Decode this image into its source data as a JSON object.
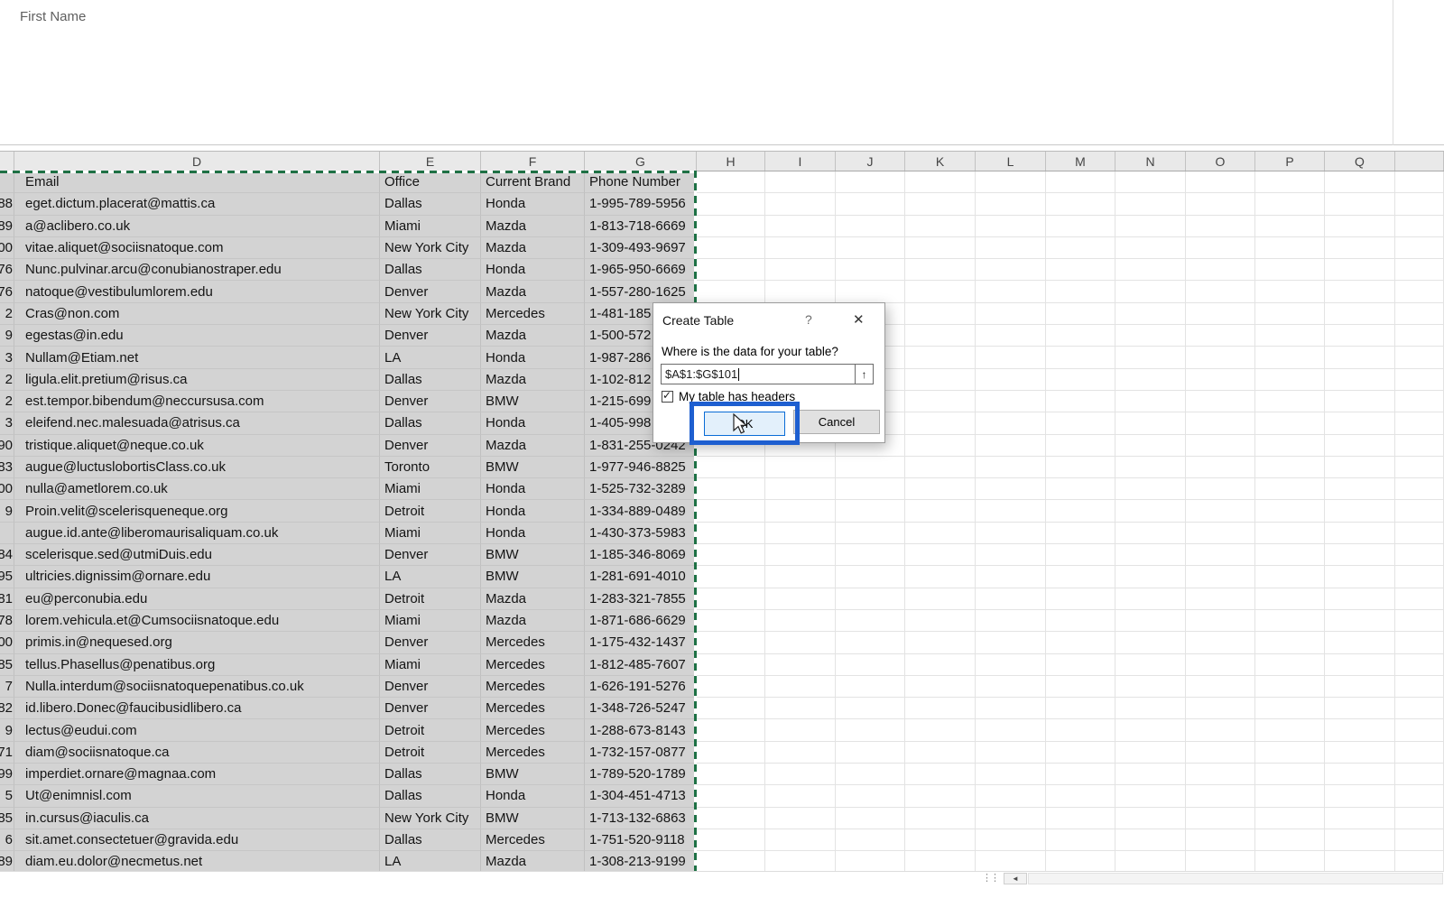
{
  "top": {
    "formula_text": "First Name"
  },
  "sheet": {
    "column_letters": [
      "",
      "D",
      "E",
      "F",
      "G",
      "H",
      "I",
      "J",
      "K",
      "L",
      "M",
      "N",
      "O",
      "P",
      "Q",
      ""
    ],
    "header_row": {
      "c": "",
      "email": "Email",
      "office": "Office",
      "brand": "Current Brand",
      "phone": "Phone Number"
    },
    "rows": [
      {
        "c": "88",
        "email": "eget.dictum.placerat@mattis.ca",
        "office": "Dallas",
        "brand": "Honda",
        "phone": "1-995-789-5956"
      },
      {
        "c": "89",
        "email": "a@aclibero.co.uk",
        "office": "Miami",
        "brand": "Mazda",
        "phone": "1-813-718-6669"
      },
      {
        "c": "00",
        "email": "vitae.aliquet@sociisnatoque.com",
        "office": "New York City",
        "brand": "Mazda",
        "phone": "1-309-493-9697"
      },
      {
        "c": "76",
        "email": "Nunc.pulvinar.arcu@conubianostraper.edu",
        "office": "Dallas",
        "brand": "Honda",
        "phone": "1-965-950-6669"
      },
      {
        "c": "76",
        "email": "natoque@vestibulumlorem.edu",
        "office": "Denver",
        "brand": "Mazda",
        "phone": "1-557-280-1625"
      },
      {
        "c": "2",
        "email": "Cras@non.com",
        "office": "New York City",
        "brand": "Mercedes",
        "phone": "1-481-185"
      },
      {
        "c": "9",
        "email": "egestas@in.edu",
        "office": "Denver",
        "brand": "Mazda",
        "phone": "1-500-572"
      },
      {
        "c": "3",
        "email": "Nullam@Etiam.net",
        "office": "LA",
        "brand": "Honda",
        "phone": "1-987-286"
      },
      {
        "c": "2",
        "email": "ligula.elit.pretium@risus.ca",
        "office": "Dallas",
        "brand": "Mazda",
        "phone": "1-102-812"
      },
      {
        "c": "2",
        "email": "est.tempor.bibendum@neccursusa.com",
        "office": "Denver",
        "brand": "BMW",
        "phone": "1-215-699"
      },
      {
        "c": "3",
        "email": "eleifend.nec.malesuada@atrisus.ca",
        "office": "Dallas",
        "brand": "Honda",
        "phone": "1-405-998"
      },
      {
        "c": "90",
        "email": "tristique.aliquet@neque.co.uk",
        "office": "Denver",
        "brand": "Mazda",
        "phone": "1-831-255-0242"
      },
      {
        "c": "83",
        "email": "augue@luctuslobortisClass.co.uk",
        "office": "Toronto",
        "brand": "BMW",
        "phone": "1-977-946-8825"
      },
      {
        "c": "00",
        "email": "nulla@ametlorem.co.uk",
        "office": "Miami",
        "brand": "Honda",
        "phone": "1-525-732-3289"
      },
      {
        "c": "9",
        "email": "Proin.velit@scelerisqueneque.org",
        "office": "Detroit",
        "brand": "Honda",
        "phone": "1-334-889-0489"
      },
      {
        "c": "",
        "email": "augue.id.ante@liberomaurisaliquam.co.uk",
        "office": "Miami",
        "brand": "Honda",
        "phone": "1-430-373-5983"
      },
      {
        "c": "84",
        "email": "scelerisque.sed@utmiDuis.edu",
        "office": "Denver",
        "brand": "BMW",
        "phone": "1-185-346-8069"
      },
      {
        "c": "95",
        "email": "ultricies.dignissim@ornare.edu",
        "office": "LA",
        "brand": "BMW",
        "phone": "1-281-691-4010"
      },
      {
        "c": "81",
        "email": "eu@perconubia.edu",
        "office": "Detroit",
        "brand": "Mazda",
        "phone": "1-283-321-7855"
      },
      {
        "c": "78",
        "email": "lorem.vehicula.et@Cumsociisnatoque.edu",
        "office": "Miami",
        "brand": "Mazda",
        "phone": "1-871-686-6629"
      },
      {
        "c": "00",
        "email": "primis.in@nequesed.org",
        "office": "Denver",
        "brand": "Mercedes",
        "phone": "1-175-432-1437"
      },
      {
        "c": "85",
        "email": "tellus.Phasellus@penatibus.org",
        "office": "Miami",
        "brand": "Mercedes",
        "phone": "1-812-485-7607"
      },
      {
        "c": "7",
        "email": "Nulla.interdum@sociisnatoquepenatibus.co.uk",
        "office": "Denver",
        "brand": "Mercedes",
        "phone": "1-626-191-5276"
      },
      {
        "c": "82",
        "email": "id.libero.Donec@faucibusidlibero.ca",
        "office": "Denver",
        "brand": "Mercedes",
        "phone": "1-348-726-5247"
      },
      {
        "c": "9",
        "email": "lectus@eudui.com",
        "office": "Detroit",
        "brand": "Mercedes",
        "phone": "1-288-673-8143"
      },
      {
        "c": "71",
        "email": "diam@sociisnatoque.ca",
        "office": "Detroit",
        "brand": "Mercedes",
        "phone": "1-732-157-0877"
      },
      {
        "c": "99",
        "email": "imperdiet.ornare@magnaa.com",
        "office": "Dallas",
        "brand": "BMW",
        "phone": "1-789-520-1789"
      },
      {
        "c": "5",
        "email": "Ut@enimnisl.com",
        "office": "Dallas",
        "brand": "Honda",
        "phone": "1-304-451-4713"
      },
      {
        "c": "85",
        "email": "in.cursus@iaculis.ca",
        "office": "New York City",
        "brand": "BMW",
        "phone": "1-713-132-6863"
      },
      {
        "c": "6",
        "email": "sit.amet.consectetuer@gravida.edu",
        "office": "Dallas",
        "brand": "Mercedes",
        "phone": "1-751-520-9118"
      },
      {
        "c": "89",
        "email": "diam.eu.dolor@necmetus.net",
        "office": "LA",
        "brand": "Mazda",
        "phone": "1-308-213-9199"
      }
    ]
  },
  "dialog": {
    "title": "Create Table",
    "help_label": "?",
    "close_label": "✕",
    "prompt": "Where is the data for your table?",
    "range_value": "$A$1:$G$101",
    "collapse_icon": "↑",
    "checkbox_label": "My table has headers",
    "checkbox_checked": true,
    "check_glyph": "✓",
    "ok_label": "OK",
    "cancel_label": "Cancel"
  },
  "scrollbar": {
    "left_arrow": "◄"
  },
  "colors": {
    "selection_fill": "#d3d3d3",
    "marching_ants_green": "#1e7145",
    "tutorial_highlight_blue": "#1e5fd0",
    "ok_button_border": "#0a6cd6",
    "ok_button_fill": "#e3f0fb"
  }
}
